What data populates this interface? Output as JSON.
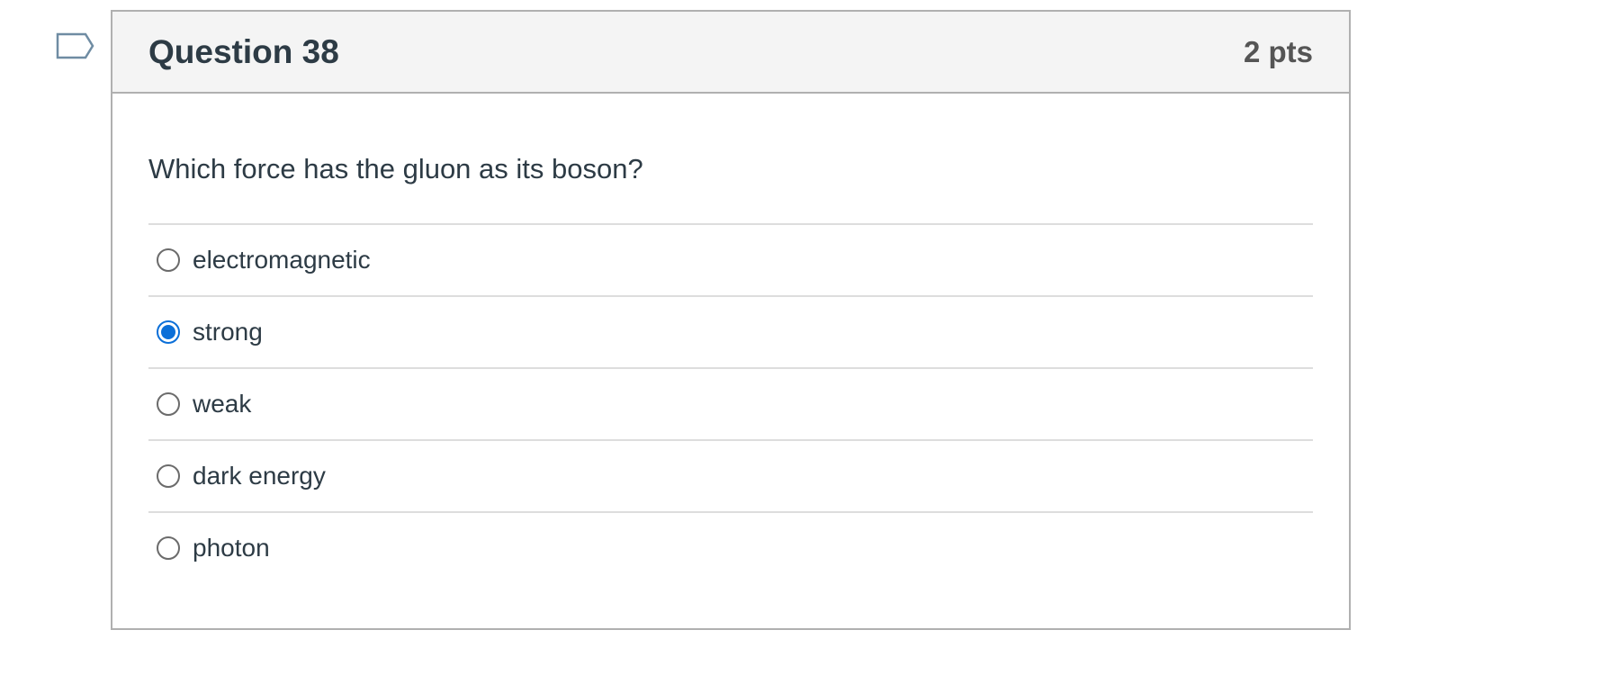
{
  "flag": {
    "icon": "bookmark-flag-icon",
    "color": "#6f8ca3"
  },
  "question": {
    "title": "Question 38",
    "points": "2 pts",
    "text": "Which force has the gluon as its boson?",
    "answers": [
      {
        "label": "electromagnetic",
        "selected": false
      },
      {
        "label": "strong",
        "selected": true
      },
      {
        "label": "weak",
        "selected": false
      },
      {
        "label": "dark energy",
        "selected": false
      },
      {
        "label": "photon",
        "selected": false
      }
    ]
  },
  "colors": {
    "accent": "#0b6fd8",
    "header_bg": "#f4f4f4",
    "text": "#2d3b45",
    "border": "#b0b0b0"
  }
}
